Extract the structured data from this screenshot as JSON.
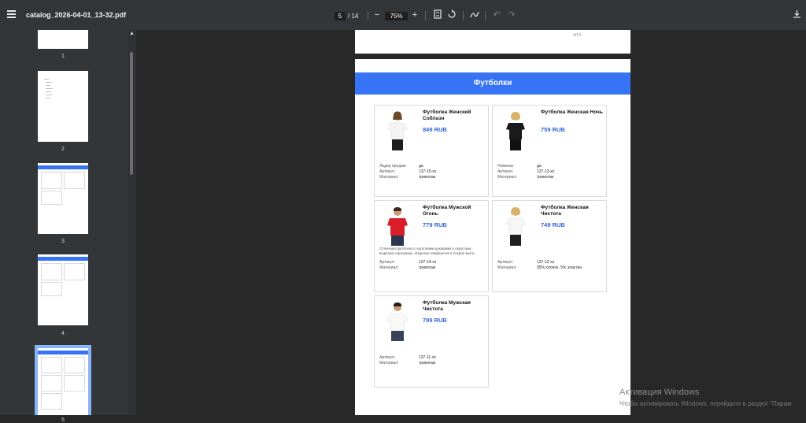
{
  "toolbar": {
    "title": "catalog_2026-04-01_13-32.pdf",
    "current_page": "5",
    "total_pages": "/ 14",
    "zoom": "75%",
    "icons": [
      "menu-icon",
      "zoom-out-icon",
      "zoom-in-icon",
      "fit-page-icon",
      "rotate-icon",
      "annotate-icon",
      "undo-icon",
      "redo-icon",
      "download-icon"
    ]
  },
  "sidebar": {
    "thumbnails": [
      {
        "label": "1"
      },
      {
        "label": "2"
      },
      {
        "label": "3"
      },
      {
        "label": "4"
      },
      {
        "label": "5"
      }
    ],
    "selected_index": 4
  },
  "document": {
    "prev_page_number": "4/14",
    "section_title": "Футболки",
    "products": [
      {
        "name": "Футболка Женский Соблазн",
        "price": "849 RUB",
        "description": "",
        "rows": [
          {
            "k": "Лидер продаж:",
            "v": "да"
          },
          {
            "k": "Артикул:",
            "v": "137-15-хх"
          },
          {
            "k": "Материал:",
            "v": "трикотаж"
          }
        ]
      },
      {
        "name": "Футболка Женская Ночь",
        "price": "759 RUB",
        "description": "",
        "rows": [
          {
            "k": "Новинка:",
            "v": "да"
          },
          {
            "k": "Артикул:",
            "v": "137-13-хх"
          },
          {
            "k": "Материал:",
            "v": "трикотаж"
          }
        ]
      },
      {
        "name": "Футболка Мужской Огонь",
        "price": "779 RUB",
        "description": "Отличная футболка с короткими рукавами и округлым вырезом горловины. Изделие комфортного покроя выпо...",
        "rows": [
          {
            "k": "Артикул:",
            "v": "137-14-хх"
          },
          {
            "k": "Материал:",
            "v": "трикотаж"
          }
        ]
      },
      {
        "name": "Футболка Женская Чистота",
        "price": "749 RUB",
        "description": "",
        "rows": [
          {
            "k": "Артикул:",
            "v": "137-12-хх"
          },
          {
            "k": "Материал:",
            "v": "95% хлопок, 5% эластан"
          }
        ]
      },
      {
        "name": "Футболка Мужская Чистота",
        "price": "799 RUB",
        "description": "",
        "rows": [
          {
            "k": "Артикул:",
            "v": "137-11-хх"
          },
          {
            "k": "Материал:",
            "v": "трикотаж"
          }
        ]
      }
    ]
  },
  "watermark": {
    "line1": "Активация Windows",
    "line2": "Чтобы активировать Windows, перейдите в раздел \"Парам"
  },
  "colors": {
    "accent": "#3673f5",
    "price": "#2f63d8",
    "toolbar": "#333639",
    "viewer_bg": "#282828"
  }
}
